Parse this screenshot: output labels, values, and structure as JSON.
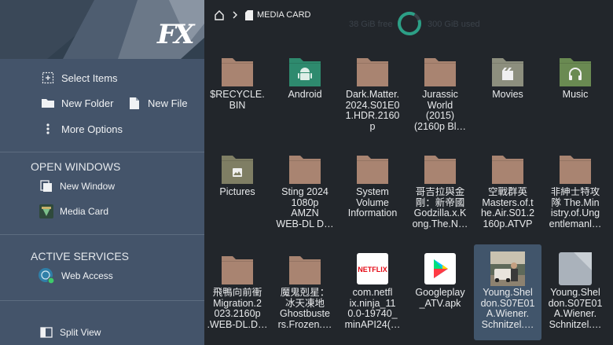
{
  "app": {
    "logo": "FX"
  },
  "sidebar": {
    "actions": {
      "select_items": "Select Items",
      "new_folder": "New Folder",
      "new_file": "New File",
      "more_options": "More Options"
    },
    "open_windows": {
      "heading": "OPEN WINDOWS",
      "new_window": "New Window",
      "media_card": "Media Card"
    },
    "active_services": {
      "heading": "ACTIVE SERVICES",
      "web_access": "Web Access"
    },
    "split_view": "Split View"
  },
  "breadcrumb": {
    "location": "MEDIA CARD"
  },
  "storage": {
    "free": "38 GiB free",
    "used": "300 GiB used"
  },
  "files": [
    {
      "name": "$RECYCLE.\nBIN",
      "icon": "folder-icon"
    },
    {
      "name": "Android",
      "icon": "android-folder-icon"
    },
    {
      "name": "Dark.Matter.\n2024.S01E0\n1.HDR.2160\np",
      "icon": "folder-icon"
    },
    {
      "name": "Jurassic\nWorld\n(2015)\n(2160p Bl…",
      "icon": "folder-icon"
    },
    {
      "name": "Movies",
      "icon": "movies-folder-icon"
    },
    {
      "name": "Music",
      "icon": "music-folder-icon"
    },
    {
      "name": "Pictures",
      "icon": "pictures-folder-icon"
    },
    {
      "name": "Sting 2024\n1080p\nAMZN\nWEB-DL D…",
      "icon": "folder-icon"
    },
    {
      "name": "System\nVolume\nInformation",
      "icon": "folder-icon"
    },
    {
      "name": "哥吉拉與金\n剛：新帝國\nGodzilla.x.K\nong.The.N…",
      "icon": "folder-icon"
    },
    {
      "name": "空戰群英\nMasters.of.t\nhe.Air.S01.2\n160p.ATVP",
      "icon": "folder-icon"
    },
    {
      "name": "非紳士特攻\n隊 The.Min\nistry.of.Ung\nentlemanl…",
      "icon": "folder-icon"
    },
    {
      "name": "飛鴨向前衝\nMigration.2\n023.2160p\n.WEB-DL.D…",
      "icon": "folder-icon"
    },
    {
      "name": "魔鬼剋星：\n冰天凍地\nGhostbuste\nrs.Frozen.…",
      "icon": "folder-icon"
    },
    {
      "name": "com.netfl\nix.ninja_11\n0.0-19740_\nminAPI24(…",
      "icon": "netflix-app-icon"
    },
    {
      "name": "Googleplay\n_ATV.apk",
      "icon": "google-play-icon"
    },
    {
      "name": "Young.Shel\ndon.S07E01\nA.Wiener.\nSchnitzel.…",
      "icon": "video-thumbnail",
      "selected": true
    },
    {
      "name": "Young.Shel\ndon.S07E01\nA.Wiener.\nSchnitzel.…",
      "icon": "generic-file-icon"
    }
  ],
  "colors": {
    "sidebar": "#44546a",
    "main_bg": "#22262b",
    "folder": "#a88471",
    "android_folder": "#2f8a6e",
    "movies_folder": "#8d8f7e",
    "music_folder": "#6a8a52",
    "pictures_folder": "#7f7e64",
    "selection": "#41556b",
    "accent": "#2c9f86"
  }
}
